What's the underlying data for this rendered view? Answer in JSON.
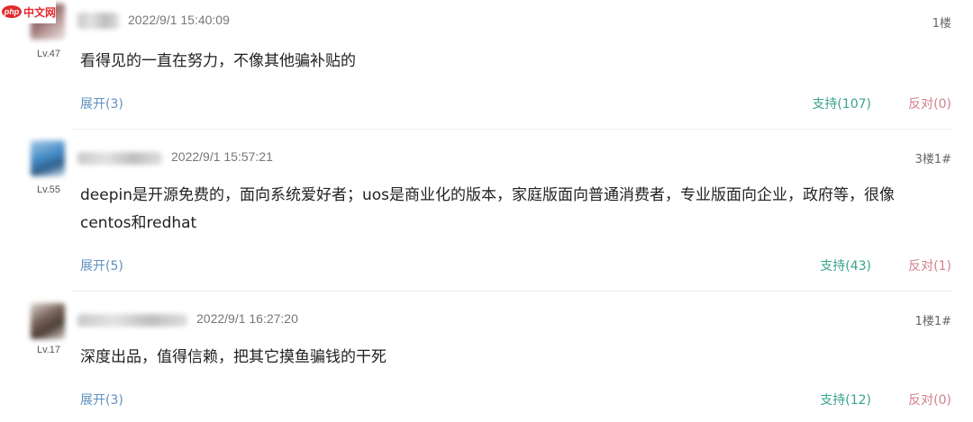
{
  "watermark": {
    "logo": "php",
    "text": "中文网"
  },
  "comments": [
    {
      "level": "Lv.47",
      "timestamp": "2022/9/1 15:40:09",
      "floor": "1楼",
      "content": "看得见的一直在努力，不像其他骗补贴的",
      "expand": "展开(3)",
      "support": "支持(107)",
      "oppose": "反对(0)"
    },
    {
      "level": "Lv.55",
      "timestamp": "2022/9/1 15:57:21",
      "floor": "3楼1#",
      "content": "deepin是开源免费的，面向系统爱好者；uos是商业化的版本，家庭版面向普通消费者，专业版面向企业，政府等，很像centos和redhat",
      "expand": "展开(5)",
      "support": "支持(43)",
      "oppose": "反对(1)"
    },
    {
      "level": "Lv.17",
      "timestamp": "2022/9/1 16:27:20",
      "floor": "1楼1#",
      "content": "深度出品，值得信赖，把其它摸鱼骗钱的干死",
      "expand": "展开(3)",
      "support": "支持(12)",
      "oppose": "反对(0)"
    }
  ],
  "colors": {
    "expand": "#5f8fc0",
    "support": "#3aa38d",
    "oppose": "#d4808c"
  }
}
